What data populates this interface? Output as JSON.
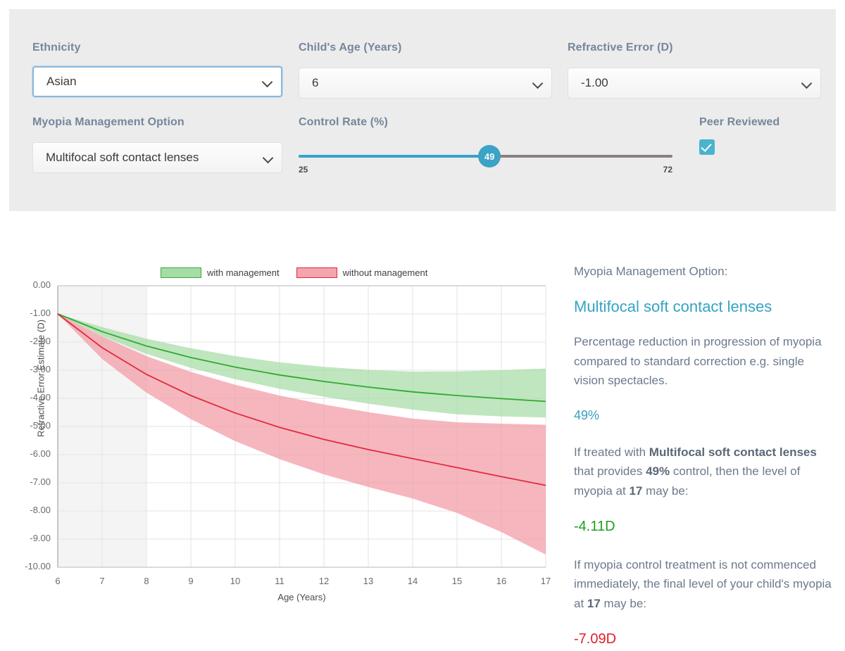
{
  "controls": {
    "ethnicity": {
      "label": "Ethnicity",
      "value": "Asian",
      "icon": "chevron-down-icon"
    },
    "age": {
      "label": "Child's Age (Years)",
      "value": "6",
      "icon": "chevron-down-icon"
    },
    "refractive_error": {
      "label": "Refractive Error (D)",
      "value": "-1.00",
      "icon": "chevron-down-icon"
    },
    "management_option": {
      "label": "Myopia Management Option",
      "value": "Multifocal soft contact lenses",
      "icon": "chevron-down-icon"
    },
    "control_rate": {
      "label": "Control Rate (%)",
      "value": "49",
      "min": "25",
      "max": "72"
    },
    "peer_reviewed": {
      "label": "Peer Reviewed",
      "checked": true,
      "icon": "checkmark-icon"
    }
  },
  "info": {
    "option_heading": "Myopia Management Option:",
    "option_name": "Multifocal soft contact lenses",
    "description": "Percentage reduction in progression of myopia compared to standard correction e.g. single vision spectacles.",
    "control_percent": "49%",
    "treated_sentence_pre": "If treated with ",
    "treated_bold_1": "Multifocal soft contact lenses",
    "treated_sentence_mid": " that provides ",
    "treated_bold_2": "49%",
    "treated_sentence_mid2": " control, then the level of myopia at ",
    "treated_bold_3": "17",
    "treated_sentence_end": " may be:",
    "treated_value": "-4.11D",
    "untreated_sentence_pre": "If myopia control treatment is not commenced immediately, the final level of your child's myopia at ",
    "untreated_bold": "17",
    "untreated_sentence_end": " may be:",
    "untreated_value": "-7.09D"
  },
  "chart_data": {
    "type": "line",
    "title": "",
    "xlabel": "Age (Years)",
    "ylabel": "Refractive Error Estimate (D)",
    "xlim": [
      6,
      17
    ],
    "ylim": [
      -10,
      0
    ],
    "xticks": [
      6,
      7,
      8,
      9,
      10,
      11,
      12,
      13,
      14,
      15,
      16,
      17
    ],
    "yticks": [
      "0.00",
      "-1.00",
      "-2.00",
      "-3.00",
      "-4.00",
      "-5.00",
      "-6.00",
      "-7.00",
      "-8.00",
      "-9.00",
      "-10.00"
    ],
    "grid": true,
    "legend_position": "top",
    "shaded_x_region": [
      6,
      8
    ],
    "x": [
      6,
      7,
      8,
      9,
      10,
      11,
      12,
      13,
      14,
      15,
      16,
      17
    ],
    "series": [
      {
        "name": "with management",
        "color": "#2faa2f",
        "band_color": "#a6dda6",
        "values": [
          -1.0,
          -1.63,
          -2.14,
          -2.55,
          -2.89,
          -3.17,
          -3.4,
          -3.6,
          -3.77,
          -3.9,
          -4.01,
          -4.11
        ],
        "band_upper": [
          -1.0,
          -1.47,
          -1.88,
          -2.22,
          -2.5,
          -2.72,
          -2.88,
          -2.99,
          -3.05,
          -3.04,
          -3.0,
          -2.94
        ],
        "band_lower": [
          -1.0,
          -1.79,
          -2.42,
          -2.92,
          -3.32,
          -3.66,
          -3.94,
          -4.19,
          -4.4,
          -4.57,
          -4.64,
          -4.68
        ]
      },
      {
        "name": "without management",
        "color": "#e02b3c",
        "band_color": "#f29aa5",
        "values": [
          -1.0,
          -2.2,
          -3.15,
          -3.9,
          -4.52,
          -5.03,
          -5.46,
          -5.82,
          -6.14,
          -6.46,
          -6.78,
          -7.09
        ],
        "band_upper": [
          -1.0,
          -1.8,
          -2.5,
          -3.06,
          -3.52,
          -3.9,
          -4.22,
          -4.49,
          -4.72,
          -4.85,
          -4.9,
          -4.94
        ],
        "band_lower": [
          -1.0,
          -2.6,
          -3.8,
          -4.74,
          -5.52,
          -6.16,
          -6.7,
          -7.15,
          -7.56,
          -8.07,
          -8.75,
          -9.55
        ]
      }
    ]
  },
  "legend": [
    {
      "label": "with management",
      "swatch": "green"
    },
    {
      "label": "without management",
      "swatch": "red"
    }
  ]
}
